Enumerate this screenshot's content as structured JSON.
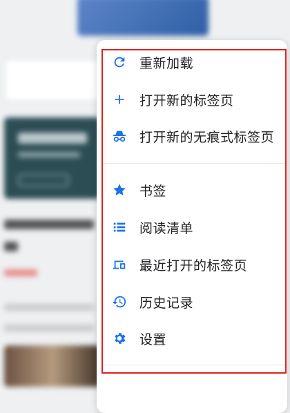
{
  "menu": {
    "items": [
      {
        "label": "重新加载",
        "icon": "reload-icon"
      },
      {
        "label": "打开新的标签页",
        "icon": "plus-icon"
      },
      {
        "label": "打开新的无痕式标签页",
        "icon": "incognito-icon"
      },
      {
        "label": "书签",
        "icon": "star-icon"
      },
      {
        "label": "阅读清单",
        "icon": "list-icon"
      },
      {
        "label": "最近打开的标签页",
        "icon": "recent-tabs-icon"
      },
      {
        "label": "历史记录",
        "icon": "history-icon"
      },
      {
        "label": "设置",
        "icon": "gear-icon"
      }
    ]
  },
  "colors": {
    "accent": "#1a73e8",
    "highlight_border": "#e0201c"
  }
}
